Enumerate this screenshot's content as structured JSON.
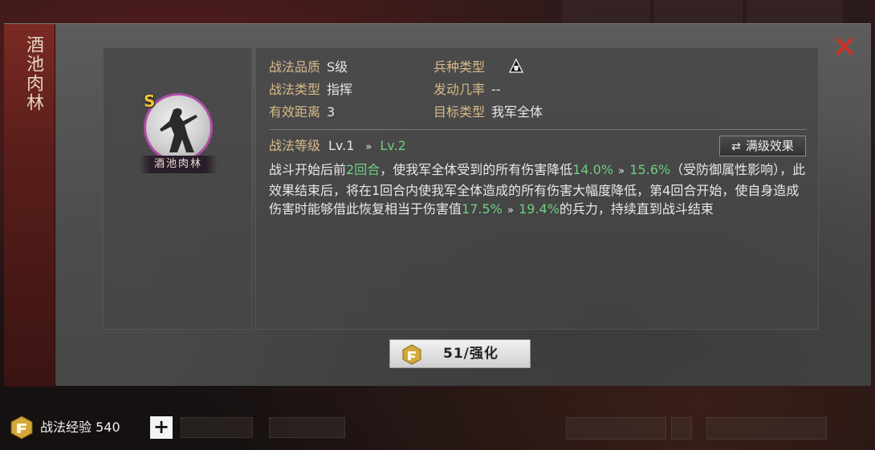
{
  "skill": {
    "name": "酒池肉林",
    "grade_badge": "S",
    "attributes": [
      {
        "key": "战法品质",
        "value": "S级"
      },
      {
        "key": "战法类型",
        "value": "指挥"
      },
      {
        "key": "有效距离",
        "value": "3"
      },
      {
        "key": "兵种类型",
        "value": ""
      },
      {
        "key": "发动几率",
        "value": "--"
      },
      {
        "key": "目标类型",
        "value": "我军全体"
      }
    ],
    "level_label": "战法等级",
    "level_current": "Lv.1",
    "level_next": "Lv.2",
    "level_arrow": "»",
    "max_level_button": "满级效果",
    "max_level_icon": "⇄",
    "description": [
      {
        "t": "战斗开始后前"
      },
      {
        "t": "2回合",
        "g": true
      },
      {
        "t": "，使我军全体受到的所有伤害降低"
      },
      {
        "t": "14.0%",
        "g": true
      },
      {
        "t": " » ",
        "arrow": true
      },
      {
        "t": "15.6%",
        "g": true
      },
      {
        "t": "（受防御属性影响），此效果结束后，将在1回合内使我军全体造成的所有伤害大幅度降低，第4回合开始，使自身造成伤害时能够借此恢复相当于伤害值"
      },
      {
        "t": "17.5%",
        "g": true
      },
      {
        "t": " » ",
        "arrow": true
      },
      {
        "t": "19.4%",
        "g": true
      },
      {
        "t": "的兵力，持续直到战斗结束"
      }
    ],
    "enhance_button": "51/强化"
  },
  "close_icon": "×",
  "bottom": {
    "exp_label": "战法经验 540",
    "plus": "+"
  },
  "icons": {
    "close": "close-icon",
    "troop": "troop-type-icon",
    "enhance": "enhance-icon",
    "exp": "exp-icon",
    "swap": "swap-icon"
  },
  "colors": {
    "accent_red": "#c8342a",
    "green_highlight": "#6fce80",
    "label_gold": "#d8b98a",
    "avatar_border": "#b04ca8"
  }
}
